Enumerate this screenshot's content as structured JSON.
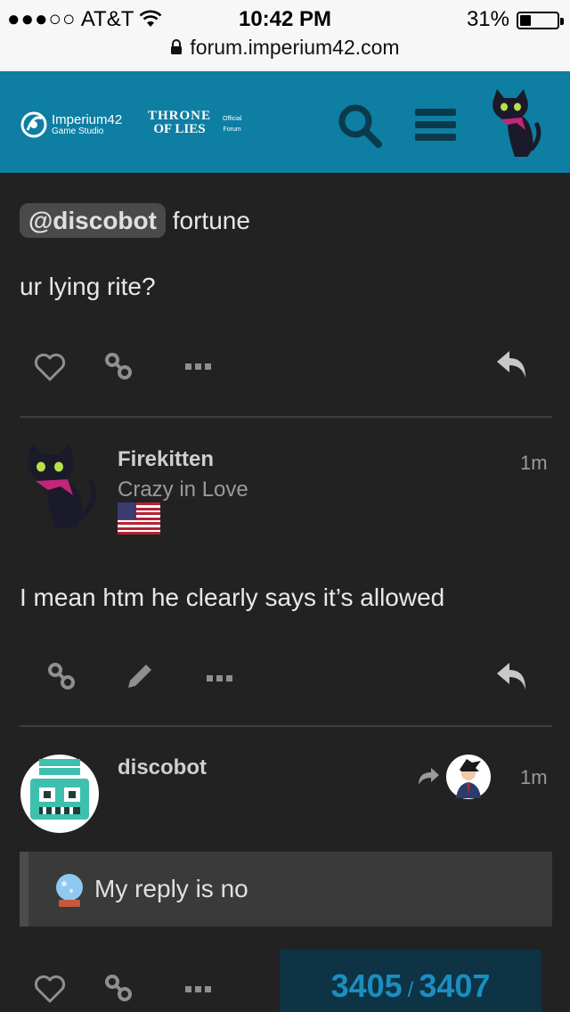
{
  "status_bar": {
    "carrier_dots": "●●●○○",
    "carrier": "AT&T",
    "time": "10:42 PM",
    "battery_percent": "31%",
    "battery_level": 0.31
  },
  "url_bar": {
    "url": "forum.imperium42.com"
  },
  "header": {
    "studio_name": "Imperium42",
    "studio_sub": "Game Studio",
    "game_line1": "THRONE",
    "game_line2": "OF LIES",
    "official_line1": "Official",
    "official_line2": "Forum",
    "icons": [
      "search-icon",
      "hamburger-menu-icon",
      "user-avatar"
    ]
  },
  "posts": [
    {
      "mention": "@discobot",
      "command": " fortune",
      "body": "ur lying rite?",
      "actions": [
        "like-icon",
        "link-icon",
        "more-icon",
        "reply-icon"
      ]
    },
    {
      "username": "Firekitten",
      "user_title": "Crazy in Love",
      "flag": "us-flag",
      "time": "1m",
      "body": "I mean htm he clearly says it’s allowed",
      "actions": [
        "link-icon",
        "edit-icon",
        "more-icon",
        "reply-icon"
      ]
    },
    {
      "username": "discobot",
      "time": "1m",
      "quote": "My reply is no",
      "actions": [
        "like-icon",
        "link-icon",
        "more-icon"
      ]
    }
  ],
  "progress": {
    "current": "3405",
    "separator": "/",
    "total": "3407"
  },
  "colors": {
    "header_bg": "#0e7ea3",
    "page_bg": "#222222",
    "progress_bg": "#0d3345",
    "progress_text": "#1b8ec1"
  }
}
